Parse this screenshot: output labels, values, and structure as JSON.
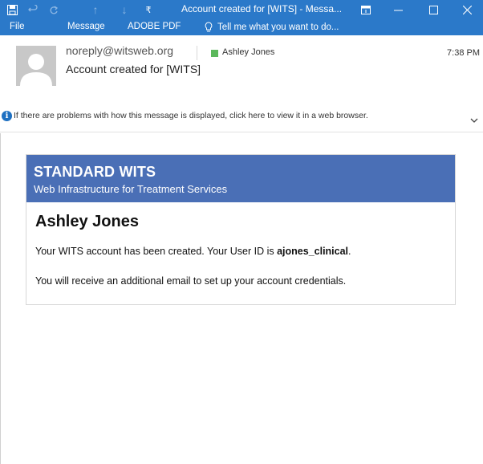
{
  "window": {
    "title": "Account created for [WITS] - Messa...",
    "quick_access": [
      "save-icon",
      "undo-icon",
      "redo-icon",
      "up-icon",
      "down-icon",
      "customize-icon"
    ],
    "controls": [
      "restore-ribbon-icon",
      "minimize-icon",
      "maximize-icon",
      "close-icon"
    ]
  },
  "menu": {
    "file": "File",
    "message": "Message",
    "adobe_pdf": "ADOBE PDF",
    "tell_me": "Tell me what you want to do..."
  },
  "header": {
    "from": "noreply@witsweb.org",
    "recipient": "Ashley Jones",
    "time": "7:38 PM",
    "subject": "Account created for [WITS]",
    "info": "If there are problems with how this message is displayed, click here to view it in a web browser."
  },
  "email": {
    "brand": "STANDARD WITS",
    "tagline": "Web Infrastructure for Treatment Services",
    "name": "Ashley Jones",
    "line1_prefix": "Your WITS account has been created. Your User ID is ",
    "user_id": "ajones_clinical",
    "line1_suffix": ".",
    "line2": "You will receive an additional email to set up your account credentials."
  },
  "colors": {
    "titlebar": "#2b79c9",
    "card_header": "#4a6fb6",
    "presence": "#5cb85c"
  }
}
